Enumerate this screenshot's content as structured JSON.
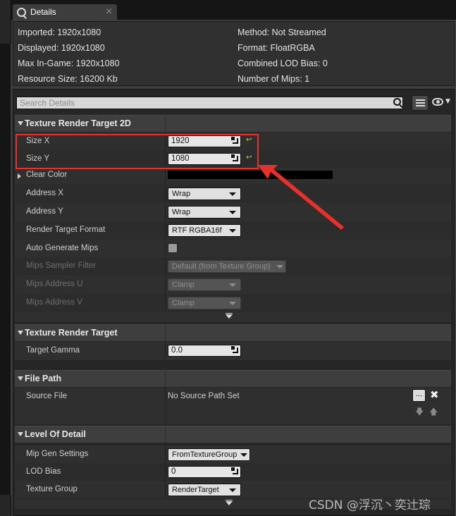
{
  "tab": {
    "label": "Details",
    "close": "×"
  },
  "info": {
    "imported": "Imported: 1920x1080",
    "displayed": "Displayed: 1920x1080",
    "max_in_game": "Max In-Game: 1920x1080",
    "resource_size": "Resource Size: 16200 Kb",
    "method": "Method: Not Streamed",
    "format": "Format: FloatRGBA",
    "combined_lod_bias": "Combined LOD Bias: 0",
    "number_of_mips": "Number of Mips: 1"
  },
  "search": {
    "placeholder": "Search Details"
  },
  "sections": {
    "texture_render_target_2d": {
      "title": "Texture Render Target 2D",
      "size_x": {
        "label": "Size X",
        "value": "1920",
        "reset": "↩"
      },
      "size_y": {
        "label": "Size Y",
        "value": "1080",
        "reset": "↩"
      },
      "clear_color": {
        "label": "Clear Color",
        "color": "#000000"
      },
      "address_x": {
        "label": "Address X",
        "value": "Wrap"
      },
      "address_y": {
        "label": "Address Y",
        "value": "Wrap"
      },
      "render_target_format": {
        "label": "Render Target Format",
        "value": "RTF RGBA16f"
      },
      "auto_generate_mips": {
        "label": "Auto Generate Mips",
        "checked": false
      },
      "mips_sampler_filter": {
        "label": "Mips Sampler Filter",
        "value": "Default (from Texture Group)"
      },
      "mips_address_u": {
        "label": "Mips Address U",
        "value": "Clamp"
      },
      "mips_address_v": {
        "label": "Mips Address V",
        "value": "Clamp"
      }
    },
    "texture_render_target": {
      "title": "Texture Render Target",
      "target_gamma": {
        "label": "Target Gamma",
        "value": "0.0"
      }
    },
    "file_path": {
      "title": "File Path",
      "source_file": {
        "label": "Source File",
        "value": "No Source Path Set",
        "browse": "..."
      }
    },
    "level_of_detail": {
      "title": "Level Of Detail",
      "mip_gen_settings": {
        "label": "Mip Gen Settings",
        "value": "FromTextureGroup"
      },
      "lod_bias": {
        "label": "LOD Bias",
        "value": "0"
      },
      "texture_group": {
        "label": "Texture Group",
        "value": "RenderTarget"
      }
    }
  },
  "annotation": {
    "color": "#e8312a"
  },
  "watermark": "CSDN @浮沉丶奕辻琮"
}
